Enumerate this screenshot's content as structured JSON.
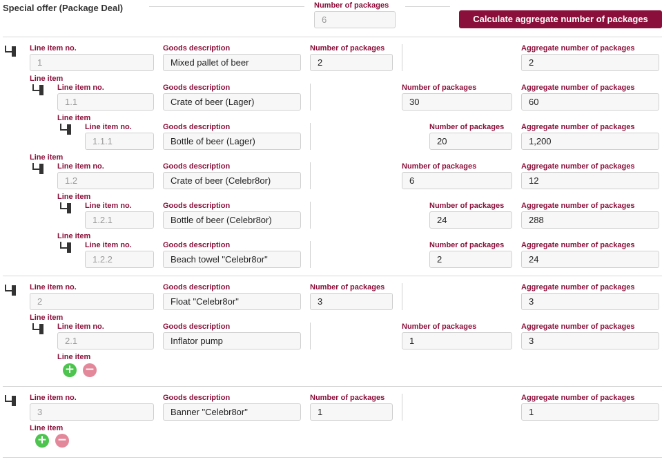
{
  "header": {
    "title": "Special offer (Package Deal)",
    "packages_label": "Number of packages",
    "packages_value": "6",
    "calc_button": "Calculate aggregate number of packages"
  },
  "labels": {
    "line_item_no": "Line item no.",
    "goods_description": "Goods description",
    "number_of_packages": "Number of packages",
    "aggregate_number_of_packages": "Aggregate number of packages",
    "line_item": "Line item"
  },
  "items": [
    {
      "no": "1",
      "desc": "Mixed pallet of beer",
      "pkgs": "2",
      "agg": "2"
    },
    {
      "no": "1.1",
      "desc": "Crate of beer (Lager)",
      "pkgs": "30",
      "agg": "60"
    },
    {
      "no": "1.1.1",
      "desc": "Bottle of beer (Lager)",
      "pkgs": "20",
      "agg": "1,200"
    },
    {
      "no": "1.2",
      "desc": "Crate of beer (Celebr8or)",
      "pkgs": "6",
      "agg": "12"
    },
    {
      "no": "1.2.1",
      "desc": "Bottle of beer (Celebr8or)",
      "pkgs": "24",
      "agg": "288"
    },
    {
      "no": "1.2.2",
      "desc": "Beach towel \"Celebr8or\"",
      "pkgs": "2",
      "agg": "24"
    },
    {
      "no": "2",
      "desc": "Float \"Celebr8or\"",
      "pkgs": "3",
      "agg": "3"
    },
    {
      "no": "2.1",
      "desc": "Inflator pump",
      "pkgs": "1",
      "agg": "3"
    },
    {
      "no": "3",
      "desc": "Banner \"Celebr8or\"",
      "pkgs": "1",
      "agg": "1"
    }
  ],
  "buttons": {
    "add": "+",
    "remove": "−"
  },
  "colors": {
    "accent": "#8a0f3a",
    "add": "#4cc44e",
    "remove": "#e3889b"
  }
}
